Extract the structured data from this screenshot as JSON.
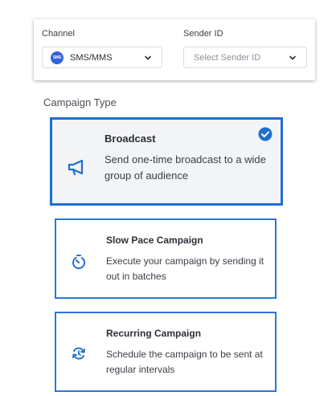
{
  "channel": {
    "label": "Channel",
    "selected": "SMS/MMS",
    "icon_text": "SMS"
  },
  "sender": {
    "label": "Sender ID",
    "placeholder": "Select Sender ID"
  },
  "campaign_type": {
    "label": "Campaign Type",
    "options": [
      {
        "title": "Broadcast",
        "description": "Send one-time broadcast to a wide group of audience",
        "icon": "megaphone-icon",
        "selected": true
      },
      {
        "title": "Slow Pace Campaign",
        "description": "Execute your campaign by sending it out in batches",
        "icon": "timer-icon",
        "selected": false
      },
      {
        "title": "Recurring Campaign",
        "description": "Schedule the campaign to be sent at regular intervals",
        "icon": "recurring-icon",
        "selected": false
      }
    ]
  },
  "colors": {
    "accent": "#1f6fd1",
    "selected_card_bg": "#f3f4f6"
  }
}
